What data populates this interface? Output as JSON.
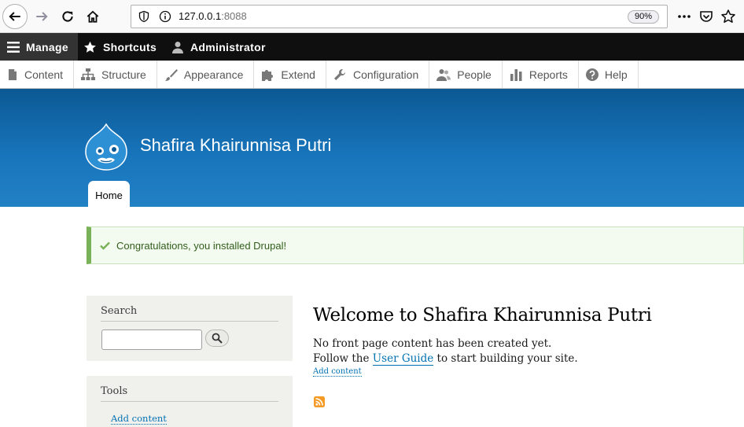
{
  "browser": {
    "url_host": "127.0.0.1",
    "url_port": ":8088",
    "zoom": "90%",
    "icons": [
      "back-arrow-icon",
      "forward-arrow-icon",
      "reload-icon",
      "home-icon",
      "shield-icon",
      "info-icon",
      "more-icon",
      "pocket-icon",
      "bookmark-star-icon"
    ]
  },
  "admin_toolbar": {
    "manage": "Manage",
    "shortcuts": "Shortcuts",
    "user": "Administrator"
  },
  "tray": {
    "items": [
      "Content",
      "Structure",
      "Appearance",
      "Extend",
      "Configuration",
      "People",
      "Reports",
      "Help"
    ]
  },
  "header": {
    "site_name": "Shafira Khairunnisa Putri",
    "home_tab": "Home"
  },
  "message": {
    "text": "Congratulations, you installed Drupal!",
    "color": "#77b259"
  },
  "sidebar": {
    "search_title": "Search",
    "search_value": "",
    "tools_title": "Tools",
    "tools_link": "Add content"
  },
  "main": {
    "title": "Welcome to Shafira Khairunnisa Putri",
    "line1": "No front page content has been created yet.",
    "line2_before": "Follow the ",
    "line2_link": "User Guide",
    "line2_after": " to start building your site.",
    "add_content": "Add content"
  },
  "colors": {
    "header_blue": "#1976bd",
    "link": "#0071b3",
    "toolbar_black": "#0f0f0f"
  }
}
